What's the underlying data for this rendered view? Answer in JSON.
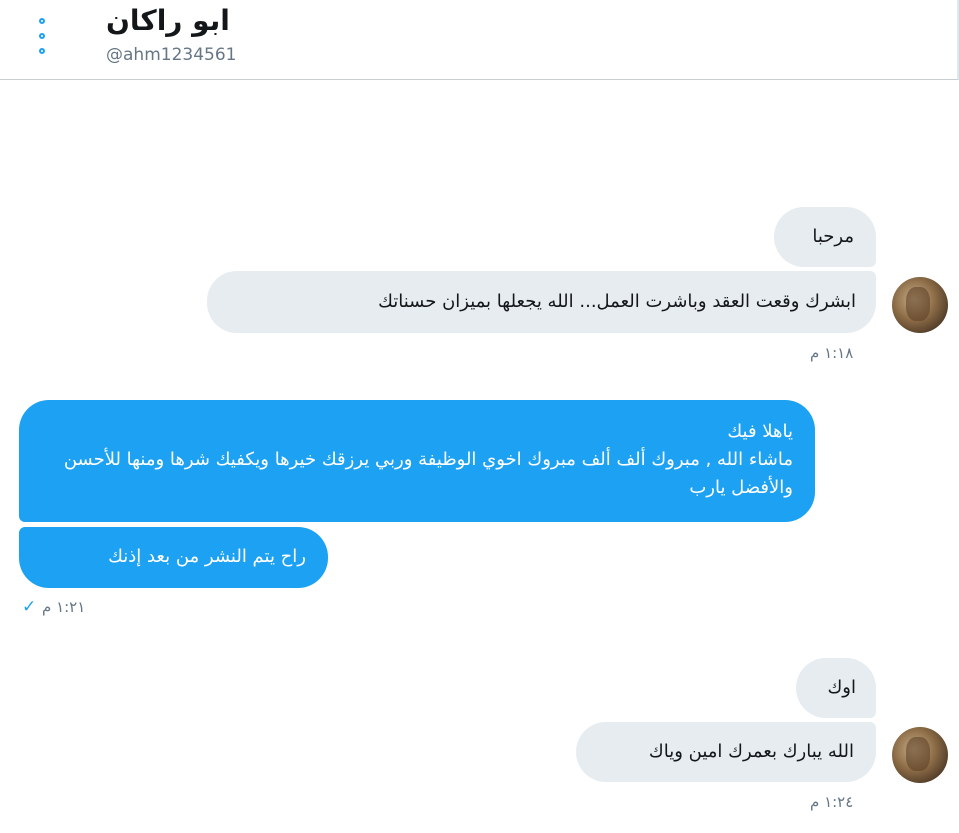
{
  "header": {
    "title": "ابو راكان",
    "handle": "@ahm1234561"
  },
  "colors": {
    "accent": "#1da1f2",
    "incoming_bubble": "#e6ecf0",
    "timestamp": "#657786"
  },
  "icons": {
    "menu": "more-vertical-icon",
    "sent": "checkmark-icon"
  },
  "conversation": {
    "group1": {
      "messages": [
        "مرحبا",
        "ابشرك وقعت العقد وباشرت العمل... الله يجعلها بميزان حسناتك"
      ],
      "time": "١:١٨ م"
    },
    "group2": {
      "messages": [
        "ياهلا فيك\nماشاء الله , مبروك ألف ألف مبروك اخوي الوظيفة وربي يرزقك خيرها ويكفيك شرها ومنها للأحسن والأفضل يارب",
        "راح يتم النشر من بعد إذنك"
      ],
      "time": "١:٢١ م"
    },
    "group3": {
      "messages": [
        "اوك",
        "الله يبارك بعمرك امين وياك"
      ],
      "time": "١:٢٤ م"
    }
  }
}
